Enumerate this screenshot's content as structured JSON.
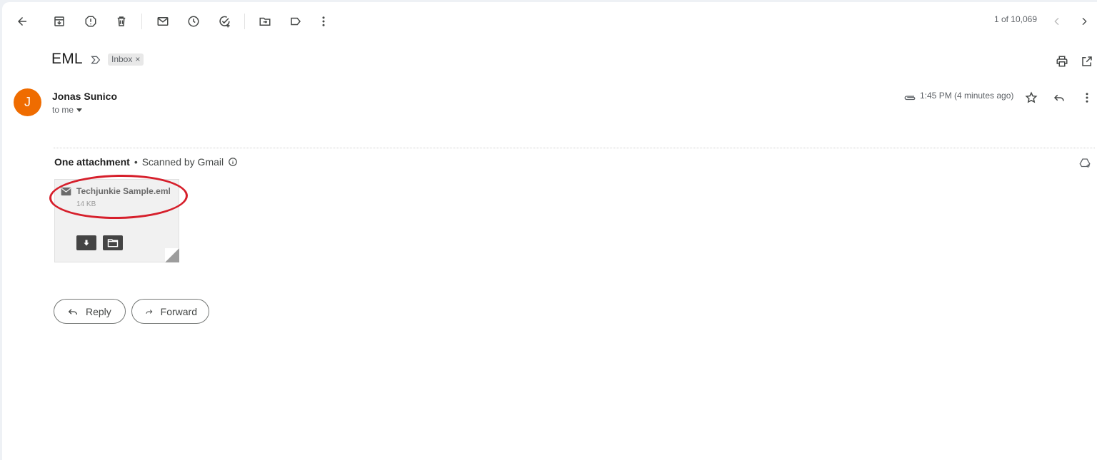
{
  "toolbar": {
    "items": [
      {
        "name": "back",
        "icon": "arrow-left-icon"
      },
      {
        "name": "archive",
        "icon": "archive-icon"
      },
      {
        "name": "report-spam",
        "icon": "report-icon"
      },
      {
        "name": "delete",
        "icon": "trash-icon"
      },
      {
        "name": "mark-unread",
        "icon": "mail-icon"
      },
      {
        "name": "snooze",
        "icon": "clock-icon"
      },
      {
        "name": "add-to-tasks",
        "icon": "add-task-icon"
      },
      {
        "name": "move-to",
        "icon": "move-folder-icon"
      },
      {
        "name": "labels",
        "icon": "label-icon"
      },
      {
        "name": "more",
        "icon": "more-vert-icon"
      }
    ],
    "pager_text": "1 of 10,069"
  },
  "email": {
    "subject": "EML",
    "label_chip": "Inbox",
    "label_close": "×",
    "sender": "Jonas Sunico",
    "sender_initial": "J",
    "recipient": "to me",
    "time": "1:45 PM (4 minutes ago)"
  },
  "attachments": {
    "heading": "One attachment",
    "separator": "•",
    "scan_note": "Scanned by Gmail",
    "file": {
      "name": "Techjunkie Sample.eml",
      "size": "14 KB"
    }
  },
  "actions": {
    "reply_label": "Reply",
    "forward_label": "Forward"
  },
  "colors": {
    "avatar": "#ef6c00",
    "annotation_ellipse": "#d61f2b"
  }
}
